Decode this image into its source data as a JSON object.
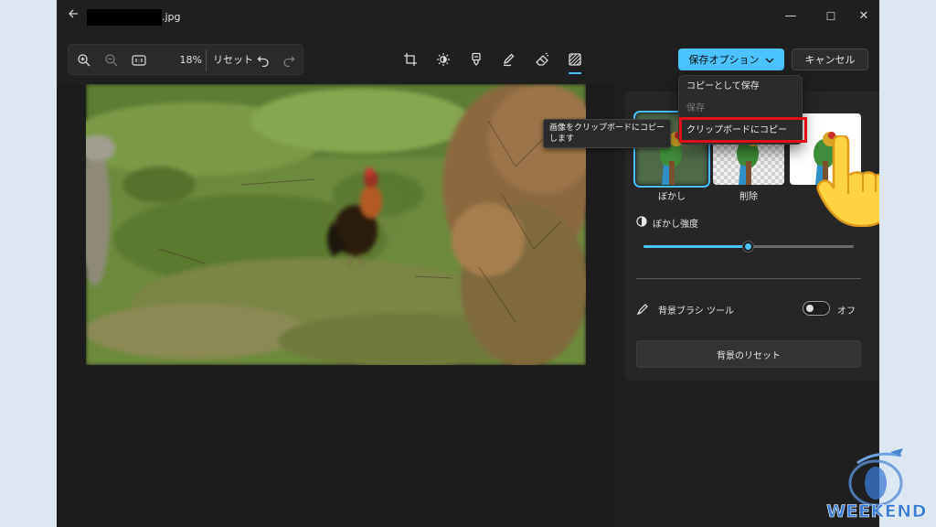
{
  "window": {
    "title": ".jpg",
    "controls": {
      "minimize": "—",
      "maximize": "☐",
      "close": "✕"
    }
  },
  "toolbar": {
    "zoom_value": "18%",
    "reset_label": "リセット",
    "icons": [
      "zoom-in-icon",
      "zoom-out-icon",
      "actual-size-icon",
      "undo-icon",
      "redo-icon"
    ]
  },
  "edit_tools": {
    "icons": [
      "crop-icon",
      "adjust-icon",
      "filter-icon",
      "markup-icon",
      "erase-icon",
      "background-icon"
    ],
    "active": "background-icon"
  },
  "actions": {
    "save_options_label": "保存オプション",
    "cancel_label": "キャンセル"
  },
  "save_menu": {
    "items": [
      {
        "label": "コピーとして保存",
        "enabled": true
      },
      {
        "label": "保存",
        "enabled": false
      },
      {
        "label": "クリップボードにコピー",
        "enabled": true,
        "highlighted": true
      }
    ]
  },
  "tooltip": {
    "line1": "画像をクリップボードにコピー",
    "line2": "します"
  },
  "background_panel": {
    "modes": [
      {
        "label": "ぼかし",
        "selected": true
      },
      {
        "label": "削除",
        "selected": false
      },
      {
        "label": "",
        "selected": false
      }
    ],
    "blur_label": "ぼかし強度",
    "blur_value": "50",
    "blur_fraction": 0.5,
    "brush_label": "背景ブラシ ツール",
    "brush_state": "オフ",
    "reset_label": "背景のリセット"
  },
  "watermark": {
    "text": "WEEKEND"
  },
  "colors": {
    "accent": "#4cc2ff",
    "highlight_box": "#e00f1a",
    "window_bg": "#1f1f1f",
    "panel_bg": "#262626"
  }
}
